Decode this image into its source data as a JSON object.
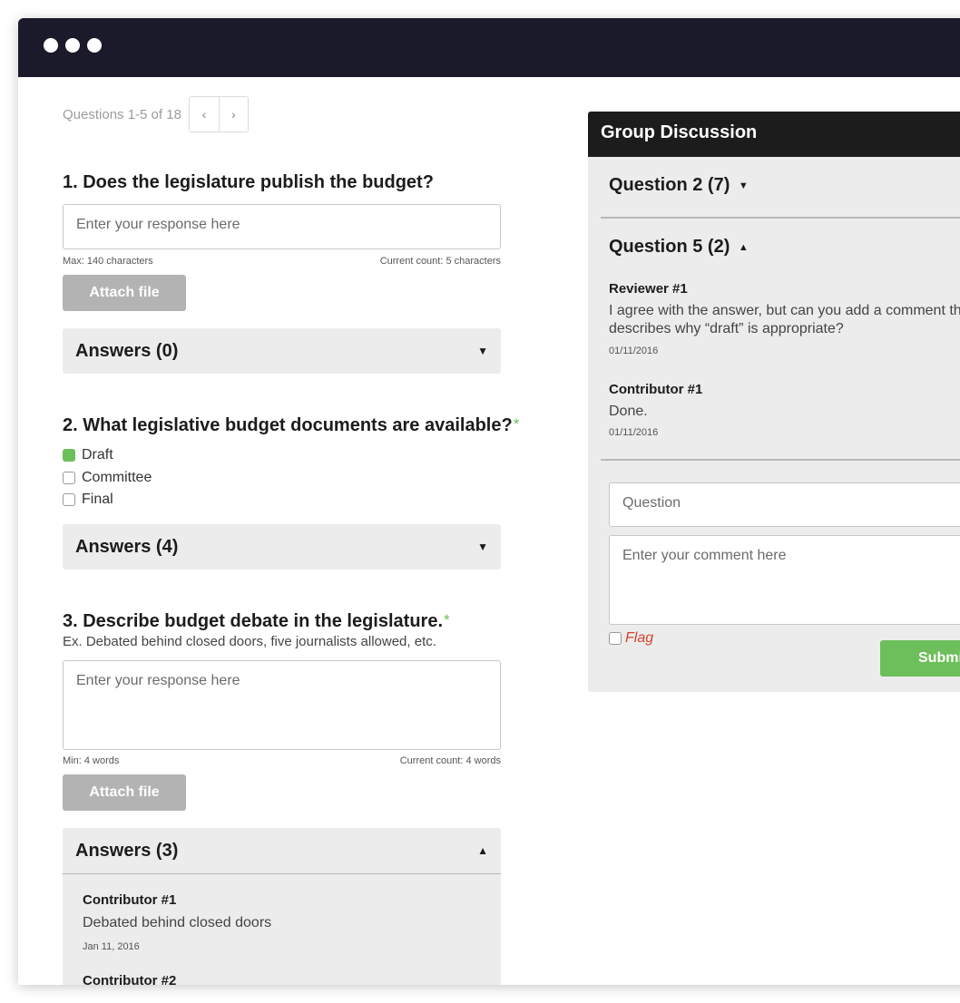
{
  "pager": {
    "label": "Questions 1-5 of 18",
    "prev": "‹",
    "next": "›"
  },
  "q1": {
    "title": "1. Does the legislature publish the budget?",
    "placeholder": "Enter your response here",
    "max": "Max: 140 characters",
    "count": "Current count: 5 characters",
    "attach": "Attach file",
    "answers": "Answers (0)"
  },
  "q2": {
    "title": "2. What legislative budget documents are available?",
    "required": "*",
    "options": [
      {
        "label": "Draft",
        "checked": true
      },
      {
        "label": "Committee",
        "checked": false
      },
      {
        "label": "Final",
        "checked": false
      }
    ],
    "answers": "Answers (4)"
  },
  "q3": {
    "title": "3. Describe budget debate in the legislature.",
    "required": "*",
    "hint": "Ex. Debated behind closed doors, five journalists allowed, etc.",
    "placeholder": "Enter your response here",
    "min": "Min: 4 words",
    "count": "Current count: 4 words",
    "attach": "Attach file",
    "answers": "Answers (3)",
    "items": [
      {
        "author": "Contributor #1",
        "text": "Debated behind closed doors",
        "date": "Jan 11, 2016"
      },
      {
        "author": "Contributor #2"
      }
    ]
  },
  "discussion": {
    "title": "Group Discussion",
    "q2": "Question 2 (7)",
    "q5": "Question 5 (2)",
    "comments": [
      {
        "author": "Reviewer #1",
        "text": "I agree with the answer, but can you add a comment that describes why “draft” is appropriate?",
        "date": "01/11/2016"
      },
      {
        "author": "Contributor #1",
        "text": "Done.",
        "date": "01/11/2016"
      }
    ],
    "select_value": "Question",
    "comment_placeholder": "Enter your comment here",
    "flag": "Flag",
    "submit": "Submit"
  },
  "icons": {
    "caret_down": "▼",
    "caret_up": "▲"
  },
  "colors": {
    "titlebar": "#1b1a2a",
    "accent_green": "#6cbf5a",
    "flag_red": "#d6412f",
    "panel_gray": "#ececec"
  }
}
